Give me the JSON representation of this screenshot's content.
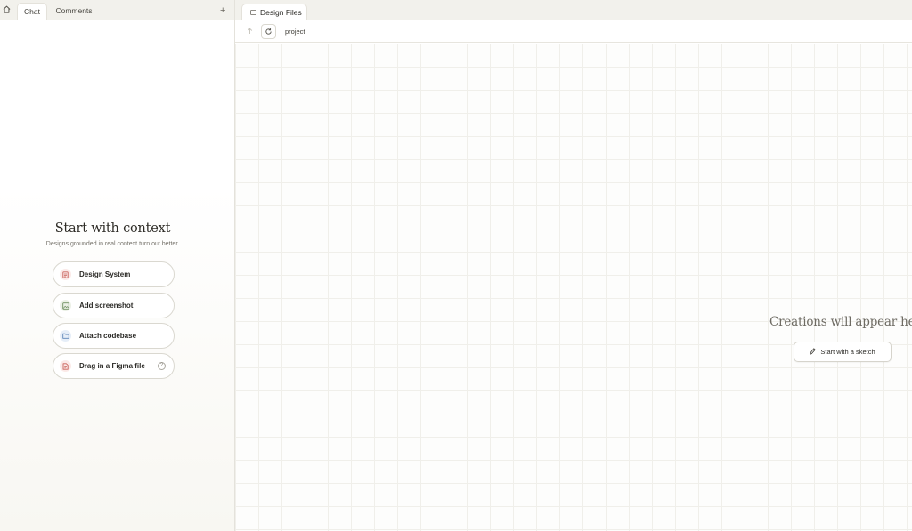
{
  "left_tabs": {
    "home_icon": "home-icon",
    "chat": "Chat",
    "comments": "Comments",
    "add": "+"
  },
  "context": {
    "title": "Start with context",
    "subtitle": "Designs grounded in real context turn out better.",
    "buttons": [
      {
        "label": "Design System",
        "icon": "design-system-icon",
        "icon_color": "#c9615a",
        "icon_bg": "#fbe9e7"
      },
      {
        "label": "Add screenshot",
        "icon": "image-icon",
        "icon_color": "#6f8f61",
        "icon_bg": "#ebf0e6"
      },
      {
        "label": "Attach codebase",
        "icon": "folder-icon",
        "icon_color": "#5f86b8",
        "icon_bg": "#e6eef8"
      },
      {
        "label": "Drag in a Figma file",
        "icon": "figma-file-icon",
        "icon_color": "#c9615a",
        "icon_bg": "#fbe9e7",
        "help": "?"
      }
    ]
  },
  "right_tabs": {
    "design_files": "Design Files",
    "design_files_icon": "file-tab-icon"
  },
  "toolbar": {
    "up_icon": "arrow-up-icon",
    "refresh_icon": "refresh-icon",
    "path": "project"
  },
  "canvas": {
    "empty_message": "Creations will appear here",
    "sketch_button": "Start with a sketch",
    "sketch_icon": "pencil-icon"
  }
}
